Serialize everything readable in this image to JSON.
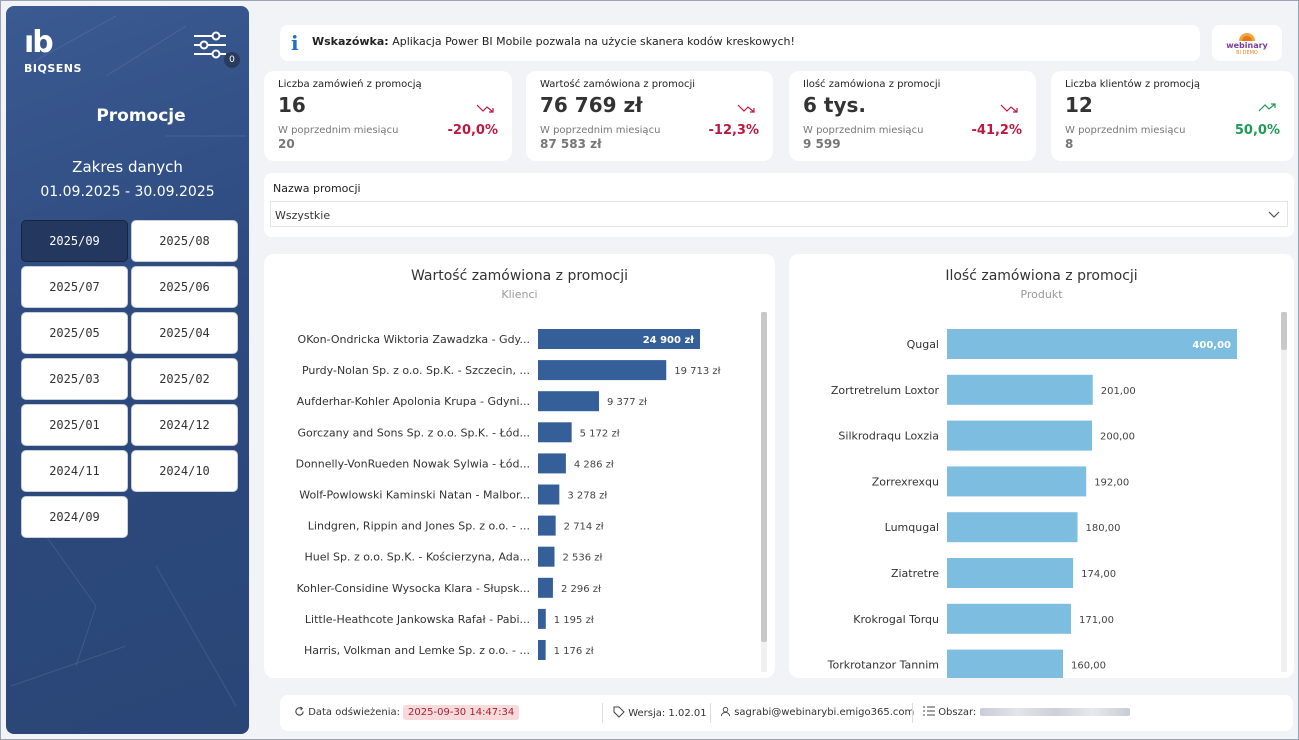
{
  "sidebar": {
    "logo_mark": "ıb",
    "logo_text": "BIQSENS",
    "filter_badge": "0",
    "page_title": "Promocje",
    "range_title": "Zakres danych",
    "range_value": "01.09.2025 - 30.09.2025",
    "periods": [
      "2025/09",
      "2025/08",
      "2025/07",
      "2025/06",
      "2025/05",
      "2025/04",
      "2025/03",
      "2025/02",
      "2025/01",
      "2024/12",
      "2024/11",
      "2024/10",
      "2024/09"
    ],
    "active_period": "2025/09"
  },
  "tip": {
    "icon": "i",
    "label": "Wskazówka:",
    "text": "Aplikacja Power BI Mobile pozwala na użycie skanera kodów kreskowych!"
  },
  "brand": {
    "name": "webinary",
    "sub": "BI DEMO"
  },
  "kpis": [
    {
      "title": "Liczba zamówień z promocją",
      "value": "16",
      "prev_label": "W poprzednim miesiącu",
      "prev_value": "20",
      "change": "-20,0%",
      "trend": "down"
    },
    {
      "title": "Wartość zamówiona z promocji",
      "value": "76 769 zł",
      "prev_label": "W poprzednim miesiącu",
      "prev_value": "87 583 zł",
      "change": "-12,3%",
      "trend": "down"
    },
    {
      "title": "Ilość zamówiona z promocji",
      "value": "6 tys.",
      "prev_label": "W poprzednim miesiącu",
      "prev_value": "9 599",
      "change": "-41,2%",
      "trend": "down"
    },
    {
      "title": "Liczba klientów z promocją",
      "value": "12",
      "prev_label": "W poprzednim miesiącu",
      "prev_value": "8",
      "change": "50,0%",
      "trend": "up"
    }
  ],
  "slicer": {
    "label": "Nazwa promocji",
    "value": "Wszystkie"
  },
  "colors": {
    "accent_dark": "#24375f",
    "bar_left": "#355f99",
    "bar_right": "#7dbde0",
    "negative": "#c0173f",
    "positive": "#1f9a57"
  },
  "chart_data": [
    {
      "type": "bar",
      "orientation": "horizontal",
      "title": "Wartość zamówiona z promocji",
      "subtitle": "Klienci",
      "categories": [
        "OKon-Ondricka Wiktoria Zawadzka - Gdy...",
        "Purdy-Nolan Sp. z o.o. Sp.K. - Szczecin, ...",
        "Aufderhar-Kohler Apolonia Krupa - Gdyni...",
        "Gorczany and Sons Sp. z o.o. Sp.K. - Łód...",
        "Donnelly-VonRueden Nowak Sylwia - Łód...",
        "Wolf-Powlowski Kaminski Natan - Malbor...",
        "Lindgren, Rippin and Jones Sp. z o.o. - ...",
        "Huel Sp. z o.o. Sp.K. - Kościerzyna, Ada...",
        "Kohler-Considine Wysocka Klara - Słupsk...",
        "Little-Heathcote Jankowska Rafał - Pabi...",
        "Harris, Volkman and Lemke Sp. z o.o. - ..."
      ],
      "values": [
        24900,
        19713,
        9377,
        5172,
        4286,
        3278,
        2714,
        2536,
        2296,
        1195,
        1176
      ],
      "labels": [
        "24 900 zł",
        "19 713 zł",
        "9 377 zł",
        "5 172 zł",
        "4 286 zł",
        "3 278 zł",
        "2 714 zł",
        "2 536 zł",
        "2 296 zł",
        "1 195 zł",
        "1 176 zł"
      ]
    },
    {
      "type": "bar",
      "orientation": "horizontal",
      "title": "Ilość zamówiona z promocji",
      "subtitle": "Produkt",
      "categories": [
        "Qugal",
        "Zortretrelum Loxtor",
        "Silkrodraqu Loxzia",
        "Zorrexrexqu",
        "Lumqugal",
        "Ziatretre",
        "Krokrogal Torqu",
        "Torkrotanzor Tannim"
      ],
      "values": [
        400,
        201,
        200,
        192,
        180,
        174,
        171,
        160
      ],
      "labels": [
        "400,00",
        "201,00",
        "200,00",
        "192,00",
        "180,00",
        "174,00",
        "171,00",
        "160,00"
      ]
    }
  ],
  "footer": {
    "refresh_label": "Data odświeżenia:",
    "refresh_value": "2025-09-30 14:47:34",
    "version": "Wersja: 1.02.01",
    "user": "sagrabi@webinarybi.emigo365.com",
    "area_label": "Obszar:"
  }
}
